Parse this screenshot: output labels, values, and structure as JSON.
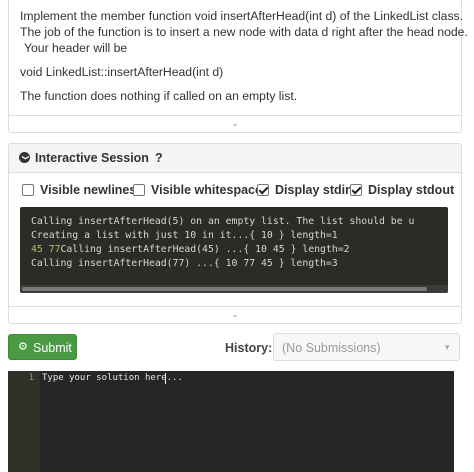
{
  "description": {
    "line1": "Implement the member function void insertAfterHead(int d) of the LinkedList class.",
    "line2": "The job of the function is to insert a new node with data d right after the head node.",
    "line3": "Your header will be",
    "signature": "void LinkedList::insertAfterHead(int d)",
    "note": "The function does nothing if called on an empty list."
  },
  "collapse_glyph": "⌄",
  "session": {
    "title": "Interactive Session",
    "help": "?",
    "toggle_glyph": "❯",
    "options": [
      {
        "label": "Visible newlines",
        "checked": false
      },
      {
        "label": "Visible whitespace",
        "checked": false
      },
      {
        "label": "Display stdin",
        "checked": true
      },
      {
        "label": "Display stdout",
        "checked": true
      }
    ],
    "console_lines": [
      {
        "stdin": "",
        "text": "Calling insertAfterHead(5) on an empty list. The list should be u"
      },
      {
        "stdin": "",
        "text": "Creating a list with just 10 in it...{ 10 } length=1"
      },
      {
        "stdin": "45 77",
        "text": "Calling insertAfterHead(45) ...{ 10 45 } length=2"
      },
      {
        "stdin": "",
        "text": "Calling insertAfterHead(77) ...{ 10 77 45 } length=3"
      }
    ]
  },
  "submit": {
    "label": "Submit",
    "icon": "gear-icon",
    "glyph": "⚙"
  },
  "history": {
    "label": "History:",
    "value": "(No Submissions)",
    "caret": "▼"
  },
  "editor": {
    "line_number": "1",
    "placeholder": "Type your solution here..."
  }
}
